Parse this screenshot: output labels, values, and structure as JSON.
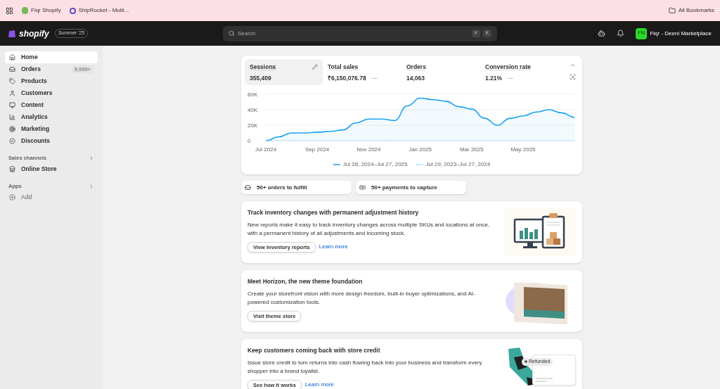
{
  "bookmarks_bar": {
    "bookmarks": [
      "Fiqr Shopify",
      "ShipRocket - Multi..."
    ],
    "all_bookmarks": "All Bookmarks"
  },
  "topbar": {
    "brand": "shopify",
    "edition": "Summer '25",
    "search": {
      "placeholder": "Search"
    },
    "shortcut_keys": [
      "⌘",
      "K"
    ],
    "store_initials": "FM",
    "store_name": "Fiqr - Deeni Marketplace"
  },
  "sidebar": {
    "items": [
      {
        "label": "Home",
        "selected": true
      },
      {
        "label": "Orders",
        "selected": false,
        "badge": "9,999+"
      },
      {
        "label": "Products",
        "selected": false
      },
      {
        "label": "Customers",
        "selected": false
      },
      {
        "label": "Content",
        "selected": false
      },
      {
        "label": "Analytics",
        "selected": false
      },
      {
        "label": "Marketing",
        "selected": false
      },
      {
        "label": "Discounts",
        "selected": false
      }
    ],
    "sections": [
      {
        "title": "Sales channels",
        "items": [
          {
            "label": "Online Store"
          }
        ]
      },
      {
        "title": "Apps",
        "items": [
          {
            "label": "Add"
          }
        ]
      }
    ]
  },
  "metrics": [
    {
      "label": "Sessions",
      "value": "355,409",
      "selected": true
    },
    {
      "label": "Total sales",
      "value": "₹6,150,076.78",
      "selected": false,
      "change": "—"
    },
    {
      "label": "Orders",
      "value": "14,063",
      "selected": false
    },
    {
      "label": "Conversion rate",
      "value": "1.21%",
      "selected": false,
      "change": "—"
    }
  ],
  "chart_data": {
    "type": "line",
    "categories": [
      "Jul 2024",
      null,
      null,
      null,
      "Sep 2024",
      null,
      null,
      null,
      "Nov 2024",
      null,
      null,
      null,
      "Jan 2025",
      null,
      null,
      null,
      "Mar 2025",
      null,
      null,
      null,
      "May 2025",
      null,
      null,
      null,
      null
    ],
    "series": [
      {
        "name": "Jul 28, 2024–Jul 27, 2025",
        "color": "#1aa3f0",
        "line_style": "solid",
        "values": [
          0,
          5000,
          10000,
          10000,
          11000,
          12000,
          14000,
          23000,
          28000,
          28000,
          26000,
          45000,
          55000,
          53000,
          51000,
          44000,
          41000,
          29000,
          20000,
          29000,
          32000,
          37000,
          40000,
          36000,
          30000
        ]
      },
      {
        "name": "Jul 29, 2023–Jul 27, 2024",
        "color": "#7cc4f2",
        "line_style": "dotted",
        "values": [
          0,
          0,
          0,
          0,
          0,
          0,
          0,
          0,
          0,
          0,
          0,
          0,
          0,
          0,
          0,
          0,
          0,
          0,
          0,
          0,
          0,
          0,
          0,
          0,
          0
        ]
      }
    ],
    "legend": true,
    "ylim": [
      0,
      60000
    ],
    "yticks": [
      {
        "value": 0,
        "label": "0"
      },
      {
        "value": 20000,
        "label": "20K"
      },
      {
        "value": 40000,
        "label": "40K"
      },
      {
        "value": 60000,
        "label": "60K"
      }
    ],
    "title": null
  },
  "tasks": [
    {
      "label": "50+ orders to fulfill"
    },
    {
      "label": "50+ payments to capture"
    }
  ],
  "cards": [
    {
      "kind": "inventory",
      "title": "Track inventory changes with permanent adjustment history",
      "body": "New reports make it easy to track inventory changes across multiple SKUs and locations at once, with a permanent history of all adjustments and incoming stock.",
      "button": "View inventory reports",
      "link": "Learn more"
    },
    {
      "kind": "theme",
      "title": "Meet Horizon, the new theme foundation",
      "body": "Create your storefront vision with more design freedom, built-in buyer optimizations, and AI-powered customization tools.",
      "button": "Visit theme store"
    },
    {
      "kind": "credit",
      "title": "Keep customers coming back with store credit",
      "body": "Issue store credit to turn returns into cash flowing back into your business and transform every shopper into a brand loyalist.",
      "button": "See how it works",
      "link": "Learn more",
      "tag": "Refunded"
    }
  ]
}
